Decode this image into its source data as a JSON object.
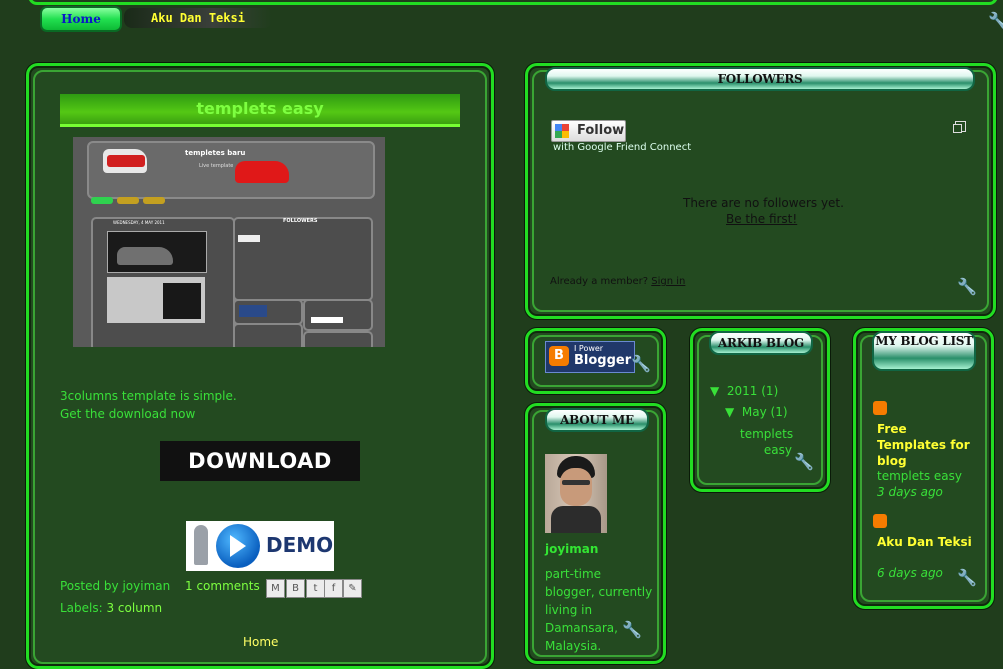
{
  "nav": {
    "home": "Home",
    "blog_title": "Aku Dan Teksi"
  },
  "post": {
    "title": "templets easy",
    "screenshot": {
      "header": "templetes baru",
      "subheader": "Live template",
      "followers": "FOLLOWERS",
      "date": "WEDNESDAY, 4 MAY 2011"
    },
    "body_line1": "3columns template is simple.",
    "body_line2": "Get the download now",
    "download": "DOWNLOAD",
    "demo": "DEMO",
    "posted_by": "Posted by joyiman",
    "comments": "1 comments",
    "labels_prefix": "Labels: ",
    "label": "3 column",
    "footer_home": "Home"
  },
  "followers": {
    "title": "FOLLOWERS",
    "follow_button": "Follow",
    "gfc": "with Google Friend Connect",
    "empty": "There are no followers yet.",
    "be_first": "Be the first!",
    "already": "Already a member? ",
    "sign_in": "Sign in"
  },
  "blogger_badge": {
    "line1": "I Power",
    "line2": "Blogger"
  },
  "about": {
    "title": "ABOUT ME",
    "name": "joyiman",
    "desc": "part-time blogger, currently living in Damansara, Malaysia."
  },
  "archive": {
    "title": "ARKIB BLOG",
    "year": "2011",
    "year_count": "(1)",
    "month": "May",
    "month_count": "(1)",
    "post": "templets easy",
    "arrow": "▼"
  },
  "bloglist": {
    "title": "MY BLOG LIST",
    "items": [
      {
        "title": "Free Templates for blog",
        "post": "templets easy",
        "age": "3 days ago"
      },
      {
        "title": "Aku Dan Teksi",
        "post": "",
        "age": "6 days ago"
      }
    ]
  },
  "colors": {
    "bg": "#203d1c",
    "accent": "#22dd22",
    "link": "#39e039",
    "heading_yellow": "#ffff33"
  },
  "icons": [
    "wrench-icon",
    "blogger-icon",
    "google-icon",
    "expand-icon",
    "email-icon",
    "blogthis-icon",
    "twitter-icon",
    "facebook-icon",
    "buzz-icon"
  ]
}
